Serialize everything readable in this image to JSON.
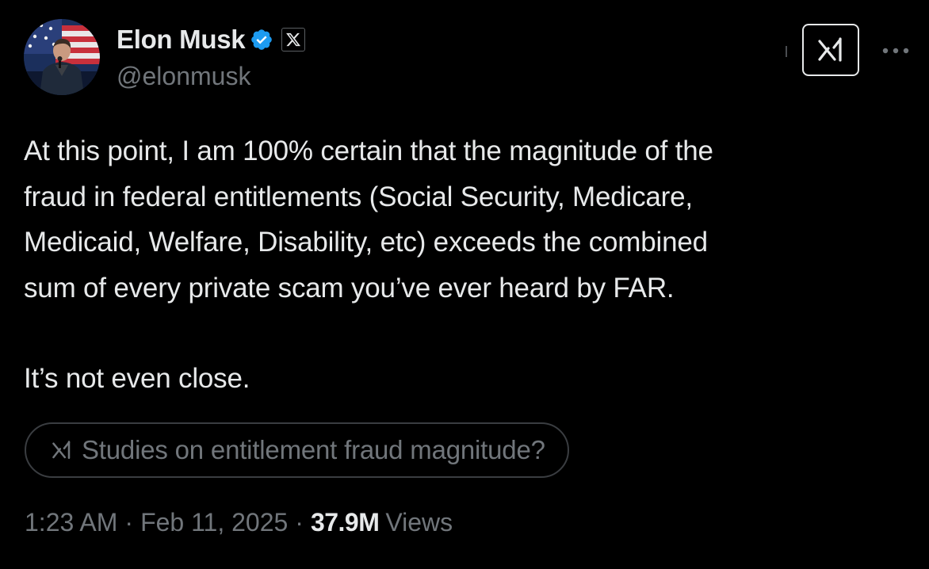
{
  "author": {
    "display_name": "Elon Musk",
    "handle": "@elonmusk",
    "verified": true,
    "verified_icon": "verified-badge-icon",
    "affiliate_icon": "x-logo-icon"
  },
  "header_actions": {
    "grok_icon": "grok-icon",
    "more_icon": "more-dots-icon"
  },
  "tweet": {
    "paragraph_1": "At this point, I am 100% certain that the magnitude of the\nfraud in federal entitlements (Social Security, Medicare,\nMedicaid, Welfare, Disability, etc) exceeds the combined\nsum of every private scam you’ve ever heard by FAR.",
    "paragraph_2": "It’s not even close."
  },
  "grok_suggestion": {
    "icon": "grok-icon",
    "text": "Studies on entitlement fraud magnitude?"
  },
  "meta": {
    "time": "1:23 AM",
    "separator": "·",
    "date": "Feb 11, 2025",
    "views_count": "37.9M",
    "views_label": "Views"
  },
  "colors": {
    "background": "#000000",
    "text_primary": "#e7e9ea",
    "text_secondary": "#71767b",
    "verified_blue": "#1d9bf0",
    "border": "#3a3d41"
  }
}
